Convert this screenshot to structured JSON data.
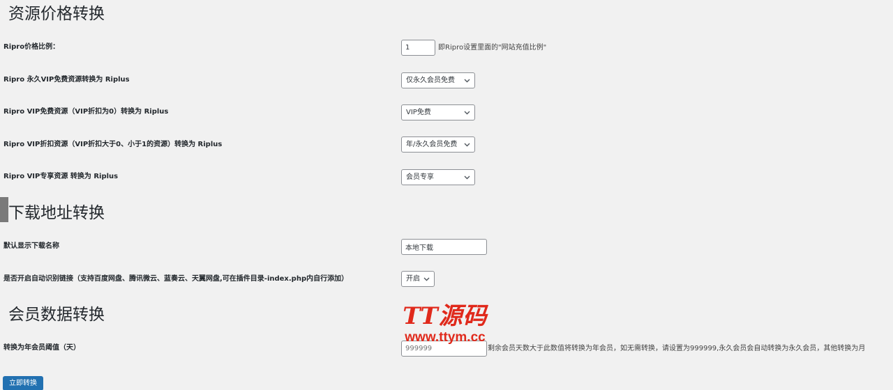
{
  "sections": {
    "price": {
      "title": "资源价格转换",
      "ratio_label": "Ripro价格比例：",
      "ratio_value": "1",
      "ratio_help": "即Ripro设置里面的\"网站充值比例\"",
      "permanent_vip_label": "Ripro 永久VIP免费资源转换为 Riplus",
      "permanent_vip_value": "仅永久会员免费",
      "vip_free_label": "Ripro VIP免费资源（VIP折扣为0）转换为 Riplus",
      "vip_free_value": "VIP免费",
      "vip_discount_label": "Ripro VIP折扣资源（VIP折扣大于0、小于1的资源）转换为 Riplus",
      "vip_discount_value": "年/永久会员免费",
      "vip_exclusive_label": "Ripro VIP专享资源 转换为 Riplus",
      "vip_exclusive_value": "会员专享"
    },
    "download": {
      "title": "下载地址转换",
      "default_name_label": "默认显示下载名称",
      "default_name_value": "本地下载",
      "auto_detect_label": "是否开启自动识别链接（支持百度网盘、腾讯微云、蓝奏云、天翼网盘,可在插件目录-index.php内自行添加）",
      "auto_detect_value": "开启"
    },
    "member": {
      "title": "会员数据转换",
      "threshold_label": "转换为年会员阈值（天）",
      "threshold_placeholder": "999999",
      "threshold_help": "剩余会员天数大于此数值将转换为年会员，如无需转换，请设置为999999,永久会员会自动转换为永久会员，其他转换为月"
    }
  },
  "actions": {
    "convert_now": "立即转换"
  },
  "watermark": {
    "logo": "TT源码",
    "url": "www.ttym.cc"
  },
  "colors": {
    "primary_button": "#2271b1",
    "watermark": "#e0291b",
    "background": "#f1f1f1"
  }
}
